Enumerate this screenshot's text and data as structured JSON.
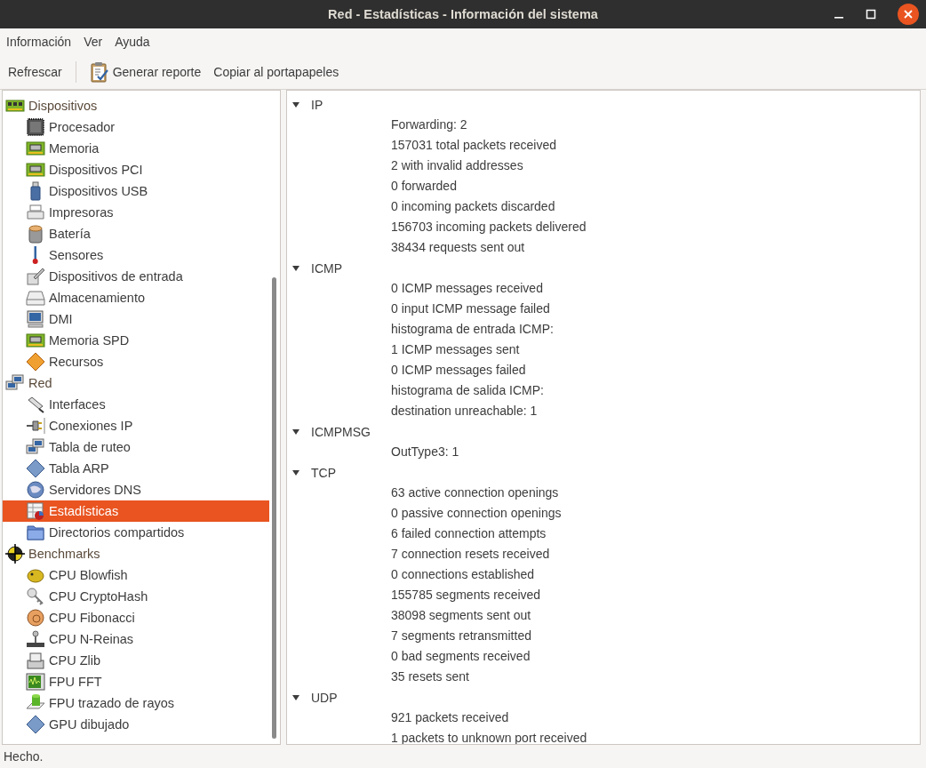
{
  "window": {
    "title": "Red - Estadísticas - Información del sistema"
  },
  "menu": [
    "Información",
    "Ver",
    "Ayuda"
  ],
  "toolbar": [
    {
      "label": "Refrescar",
      "kind": "text"
    },
    {
      "label": "Generar reporte",
      "kind": "report"
    },
    {
      "label": "Copiar al portapapeles",
      "kind": "text"
    }
  ],
  "tree": [
    {
      "label": "Dispositivos",
      "children": [
        {
          "label": "Procesador",
          "selected": false
        },
        {
          "label": "Memoria",
          "selected": false
        },
        {
          "label": "Dispositivos PCI",
          "selected": false
        },
        {
          "label": "Dispositivos USB",
          "selected": false
        },
        {
          "label": "Impresoras",
          "selected": false
        },
        {
          "label": "Batería",
          "selected": false
        },
        {
          "label": "Sensores",
          "selected": false
        },
        {
          "label": "Dispositivos de entrada",
          "selected": false
        },
        {
          "label": "Almacenamiento",
          "selected": false
        },
        {
          "label": "DMI",
          "selected": false
        },
        {
          "label": "Memoria SPD",
          "selected": false
        },
        {
          "label": "Recursos",
          "selected": false
        }
      ]
    },
    {
      "label": "Red",
      "children": [
        {
          "label": "Interfaces",
          "selected": false
        },
        {
          "label": "Conexiones IP",
          "selected": false
        },
        {
          "label": "Tabla de ruteo",
          "selected": false
        },
        {
          "label": "Tabla ARP",
          "selected": false
        },
        {
          "label": "Servidores DNS",
          "selected": false
        },
        {
          "label": "Estadísticas",
          "selected": true
        },
        {
          "label": "Directorios compartidos",
          "selected": false
        }
      ]
    },
    {
      "label": "Benchmarks",
      "children": [
        {
          "label": "CPU Blowfish",
          "selected": false
        },
        {
          "label": "CPU CryptoHash",
          "selected": false
        },
        {
          "label": "CPU Fibonacci",
          "selected": false
        },
        {
          "label": "CPU N-Reinas",
          "selected": false
        },
        {
          "label": "CPU Zlib",
          "selected": false
        },
        {
          "label": "FPU FFT",
          "selected": false
        },
        {
          "label": "FPU trazado de rayos",
          "selected": false
        },
        {
          "label": "GPU dibujado",
          "selected": false
        }
      ]
    }
  ],
  "sections": [
    {
      "title": "IP",
      "expanded": true,
      "lines": [
        "Forwarding: 2",
        "157031 total packets received",
        "2 with invalid addresses",
        "0 forwarded",
        "0 incoming packets discarded",
        "156703 incoming packets delivered",
        "38434 requests sent out"
      ]
    },
    {
      "title": "ICMP",
      "expanded": true,
      "lines": [
        "0 ICMP messages received",
        "0 input ICMP message failed",
        "histograma de entrada ICMP:",
        "1 ICMP messages sent",
        "0 ICMP messages failed",
        "histograma de salida ICMP:",
        "destination unreachable: 1"
      ]
    },
    {
      "title": "ICMPMSG",
      "expanded": true,
      "lines": [
        "OutType3: 1"
      ]
    },
    {
      "title": "TCP",
      "expanded": true,
      "lines": [
        "63 active connection openings",
        "0 passive connection openings",
        "6 failed connection attempts",
        "7 connection resets received",
        "0 connections established",
        "155785 segments received",
        "38098 segments sent out",
        "7 segments retransmitted",
        "0 bad segments received",
        "35 resets sent"
      ]
    },
    {
      "title": "UDP",
      "expanded": true,
      "lines": [
        "921 packets received",
        "1 packets to unknown port received"
      ]
    }
  ],
  "status_bar": "Hecho."
}
